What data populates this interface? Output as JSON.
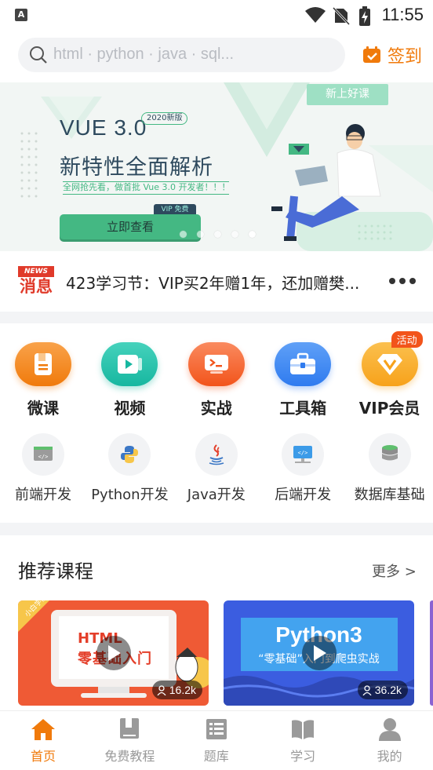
{
  "status": {
    "time": "11:55"
  },
  "search": {
    "placeholder": "html · python · java · sql..."
  },
  "signin": {
    "label": "签到"
  },
  "banner": {
    "tag": "新上好课",
    "title": "VUE 3.0",
    "edition": "2020新版",
    "headline": "新特性全面解析",
    "subtitle": "全网抢先看，做首批 Vue 3.0 开发者！！！",
    "vip_free": "VIP 免费",
    "cta": "立即查看",
    "pages": 5,
    "active_page": 5
  },
  "news": {
    "logo_top": "NEWS",
    "logo_bottom": "消息",
    "text": "423学习节：VIP买2年赠1年，还加赠樊..."
  },
  "main_menu": [
    {
      "label": "微课",
      "icon": "book-icon",
      "color": "#f07a0b"
    },
    {
      "label": "视频",
      "icon": "video-icon",
      "color": "#17b7a0"
    },
    {
      "label": "实战",
      "icon": "terminal-icon",
      "color": "#f2541b"
    },
    {
      "label": "工具箱",
      "icon": "toolbox-icon",
      "color": "#2f7bef"
    },
    {
      "label": "VIP会员",
      "icon": "vip-icon",
      "color": "#f7a21b",
      "badge": "活动"
    }
  ],
  "categories": [
    {
      "label": "前端开发",
      "icon": "frontend-icon"
    },
    {
      "label": "Python开发",
      "icon": "python-icon"
    },
    {
      "label": "Java开发",
      "icon": "java-icon"
    },
    {
      "label": "后端开发",
      "icon": "backend-icon"
    },
    {
      "label": "数据库基础",
      "icon": "database-icon"
    }
  ],
  "recommend": {
    "title": "推荐课程",
    "more": "更多 >",
    "cards": [
      {
        "line1": "HTML",
        "line2": "零基础入门",
        "corner": "小白学前端",
        "count": "16.2k"
      },
      {
        "line1": "Python3",
        "line2": "“零基础”入门到爬虫实战",
        "count": "36.2k"
      }
    ]
  },
  "nav": [
    {
      "label": "首页",
      "icon": "home-icon",
      "active": true
    },
    {
      "label": "免费教程",
      "icon": "book-icon"
    },
    {
      "label": "题库",
      "icon": "question-bank-icon"
    },
    {
      "label": "学习",
      "icon": "study-icon"
    },
    {
      "label": "我的",
      "icon": "profile-icon"
    }
  ]
}
